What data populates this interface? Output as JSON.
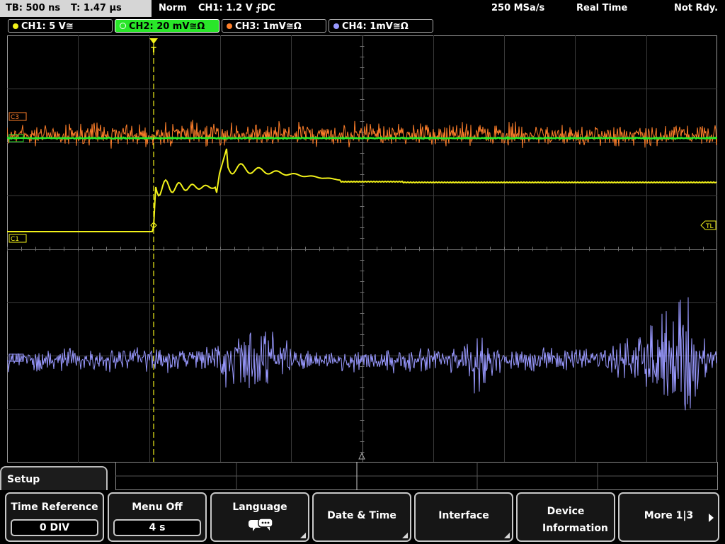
{
  "status": {
    "timebase": "TB: 500 ns",
    "trigger_time": "T: 1.47 µs",
    "mode": "Norm",
    "trigger_info": "CH1: 1.2 V ⨍DC",
    "sample_rate": "250 MSa/s",
    "acq_mode": "Real Time",
    "ready_state": "Not Rdy."
  },
  "channels": [
    {
      "label": "CH1: 5 V≅",
      "color": "#f2f21a"
    },
    {
      "label": "CH2: 20 mV≅Ω",
      "color": "#29e629"
    },
    {
      "label": "CH3: 1mV≅Ω",
      "color": "#ff7f2a"
    },
    {
      "label": "CH4: 1mV≅Ω",
      "color": "#9999ff"
    }
  ],
  "markers": {
    "c3": "C3",
    "c1": "C1",
    "tl": "TL",
    "trigger": "T"
  },
  "menu": {
    "title": "Setup",
    "keys": [
      {
        "label": "Time Reference",
        "value": "0 DIV"
      },
      {
        "label": "Menu Off",
        "value": "4 s"
      },
      {
        "label": "Language",
        "icon": "speech-bubble-icon"
      },
      {
        "label": "Date & Time"
      },
      {
        "label": "Interface"
      },
      {
        "label": "Device Information"
      },
      {
        "label": "More 1|3"
      }
    ]
  },
  "colors": {
    "grid": "#5a5a5a",
    "ch1": "#f2f21a",
    "ch2": "#29e629",
    "ch3": "#ff7f2a",
    "ch4": "#9999ff"
  }
}
